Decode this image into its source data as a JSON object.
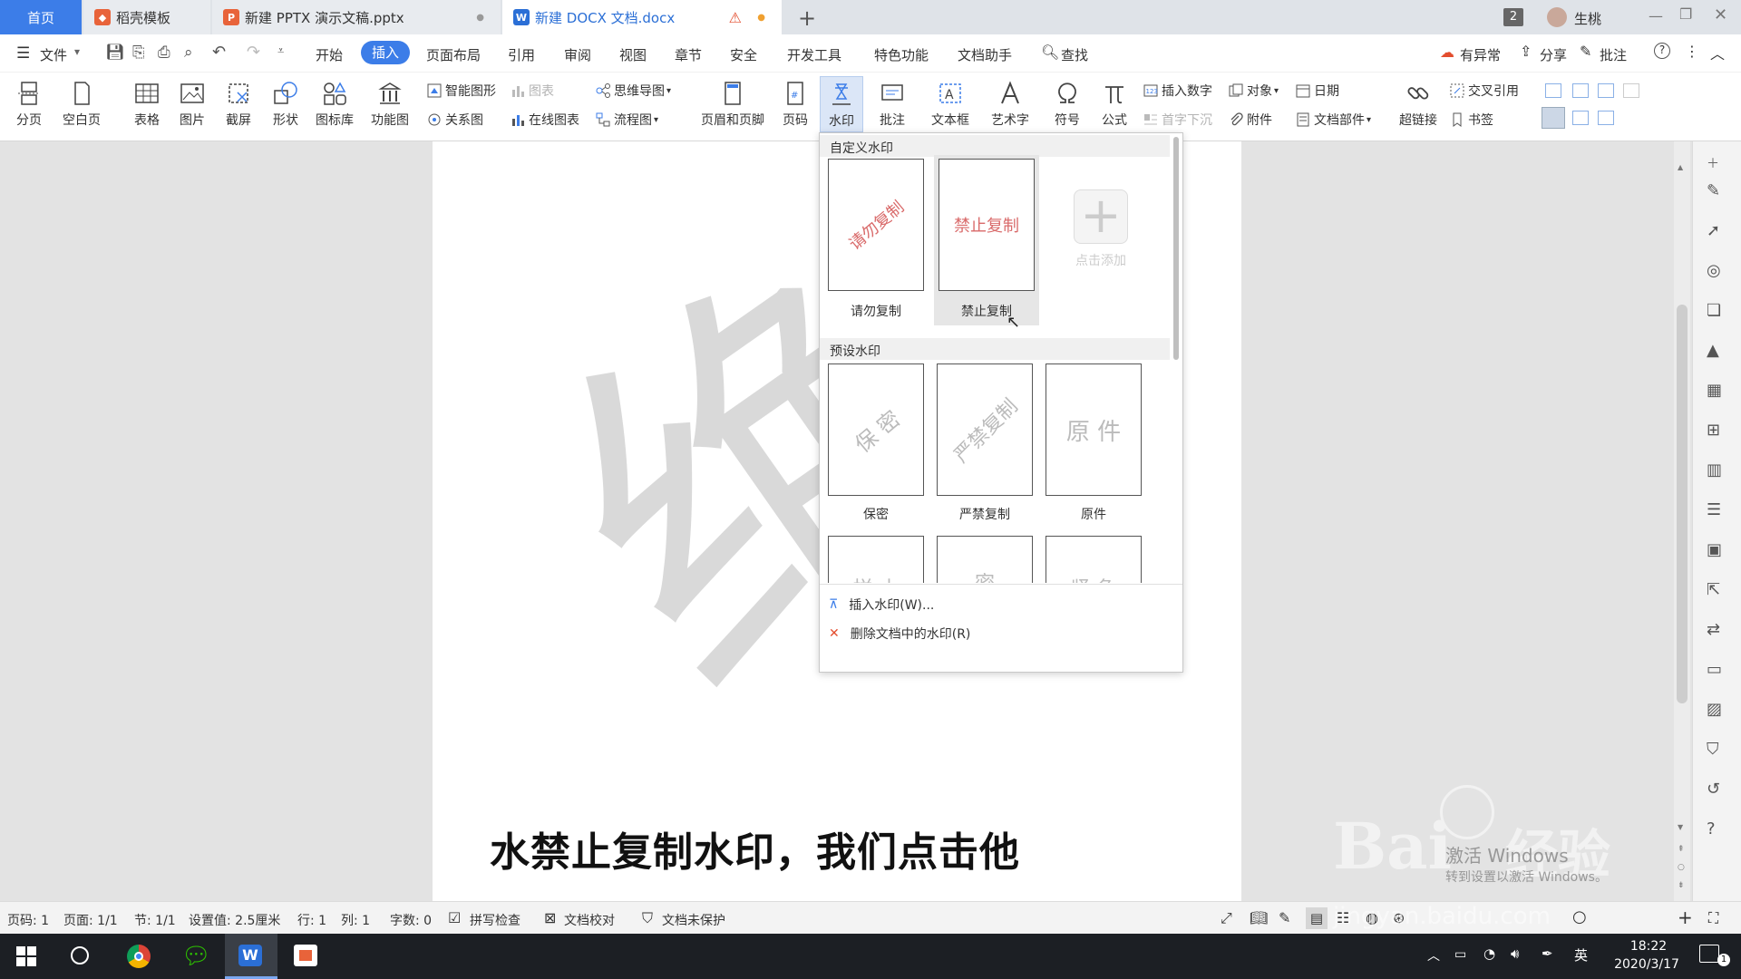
{
  "tabs": [
    {
      "label": "首页"
    },
    {
      "label": "稻壳模板"
    },
    {
      "label": "新建 PPTX 演示文稿.pptx"
    },
    {
      "label": "新建 DOCX 文档.docx"
    }
  ],
  "titlebar": {
    "badge": "2",
    "user": "生桃"
  },
  "menu": {
    "file": "文件",
    "items": [
      "开始",
      "插入",
      "页面布局",
      "引用",
      "审阅",
      "视图",
      "章节",
      "安全",
      "开发工具",
      "特色功能",
      "文档助手"
    ],
    "active": "插入",
    "search": "查找",
    "sync": "有异常",
    "share": "分享",
    "comment": "批注"
  },
  "ribbon": {
    "fenye": "分页",
    "kongbaiye": "空白页",
    "biaoge": "表格",
    "tupian": "图片",
    "jieping": "截屏",
    "xingzhuang": "形状",
    "tubiaoku": "图标库",
    "gongnengtu": "功能图",
    "zhinengtuxing": "智能图形",
    "tubiao": "图表",
    "guanxitu": "关系图",
    "zaixiantubiao": "在线图表",
    "siweidaotu": "思维导图",
    "liuchengtu": "流程图",
    "yemeiheyejiao": "页眉和页脚",
    "yema": "页码",
    "shuiyin": "水印",
    "pizhu": "批注",
    "wenbenkuang": "文本框",
    "yishuzi": "艺术字",
    "fuhao": "符号",
    "gongshi": "公式",
    "charushuzi": "插入数字",
    "duixiang": "对象",
    "riqi": "日期",
    "shouzixiachen": "首字下沉",
    "fujian": "附件",
    "wendangbujian": "文档部件",
    "chaolianjie": "超链接",
    "jiaochayinyong": "交叉引用",
    "shuqian": "书签"
  },
  "document": {
    "watermark_char": "绝",
    "subtitle": "水禁止复制水印，我们点击他"
  },
  "dropdown": {
    "custom_header": "自定义水印",
    "custom": [
      {
        "text": "请勿复制",
        "label": "请勿复制"
      },
      {
        "text": "禁止复制",
        "label": "禁止复制"
      }
    ],
    "add_label": "点击添加",
    "preset_header": "预设水印",
    "preset": [
      {
        "text": "保 密",
        "label": "保密"
      },
      {
        "text": "严禁复制",
        "label": "严禁复制"
      },
      {
        "text": "原 件",
        "label": "原件"
      }
    ],
    "preset_partial": [
      "样 本",
      "密",
      "紧 急"
    ],
    "insert_item": "插入水印(W)...",
    "delete_item": "删除文档中的水印(R)"
  },
  "statusbar": {
    "page_code": "页码: 1",
    "page": "页面: 1/1",
    "section": "节: 1/1",
    "setting": "设置值: 2.5厘米",
    "row": "行: 1",
    "col": "列: 1",
    "words": "字数: 0",
    "spell": "拼写检查",
    "proof": "文档校对",
    "protect": "文档未保护"
  },
  "overlay": {
    "baidu": "Bai",
    "jingyan": "经验",
    "url": "jingyan.baidu.com",
    "activate1": "激活 Windows",
    "activate2": "转到设置以激活 Windows。"
  },
  "taskbar": {
    "ime": "英",
    "time": "18:22",
    "date": "2020/3/17",
    "notif": "1"
  },
  "colors": {
    "accent": "#2b6fd6",
    "active_tab": "#3c7de8",
    "pptx": "#e8633a",
    "wps_red": "#e34d2e",
    "watermark_red": "#d96a6a"
  }
}
